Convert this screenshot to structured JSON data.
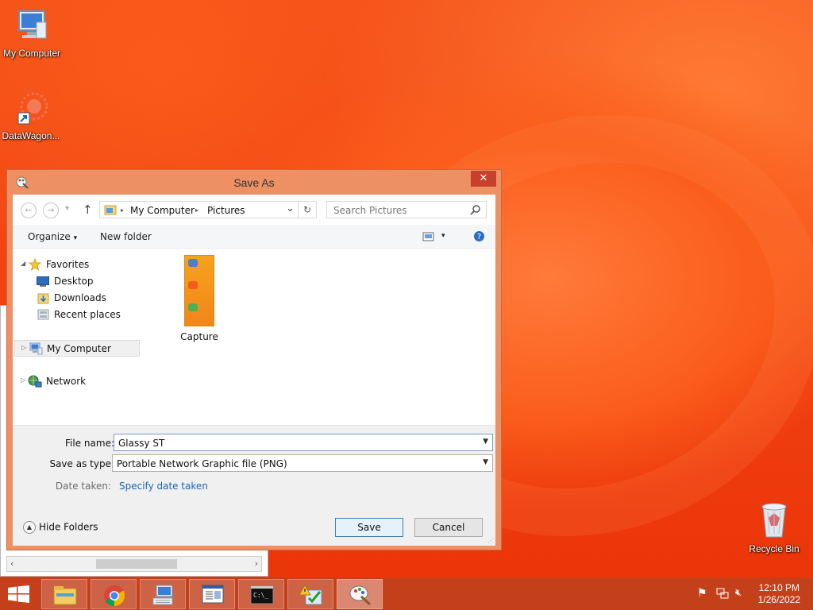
{
  "desktop": {
    "icons": [
      {
        "label": "My Computer"
      },
      {
        "label": "DataWagon..."
      },
      {
        "label": "Recycle Bin"
      }
    ]
  },
  "dialog": {
    "title": "Save As",
    "close_glyph": "✕",
    "nav": {
      "back_glyph": "←",
      "forward_glyph": "→",
      "recent_glyph": "▾",
      "up_glyph": "↑",
      "breadcrumb": [
        "My Computer",
        "Pictures"
      ],
      "sep_glyph": "▸",
      "dropdown_glyph": "⌄",
      "refresh_glyph": "↻"
    },
    "search": {
      "placeholder": "Search Pictures"
    },
    "toolbar": {
      "organize": "Organize",
      "organize_glyph": "▾",
      "new_folder": "New folder",
      "view_glyph": "▾"
    },
    "nav_pane": {
      "favorites": "Favorites",
      "desktop": "Desktop",
      "downloads": "Downloads",
      "recent_places": "Recent places",
      "my_computer": "My Computer",
      "network": "Network"
    },
    "files": [
      {
        "label": "Capture"
      }
    ],
    "file_name_label": "File name:",
    "file_name_value": "Glassy ST",
    "save_type_label": "Save as type:",
    "save_type_value": "Portable Network Graphic file (PNG)",
    "date_taken_label": "Date taken:",
    "date_taken_link": "Specify date taken",
    "hide_folders": "Hide Folders",
    "save_button": "Save",
    "cancel_button": "Cancel"
  },
  "taskbar": {
    "time": "12:10 PM",
    "date": "1/26/2022"
  },
  "colors": {
    "dialog_frame": "#ed9064",
    "close_button": "#c7402a",
    "link": "#1d66b5",
    "taskbar": "#c4401b"
  }
}
